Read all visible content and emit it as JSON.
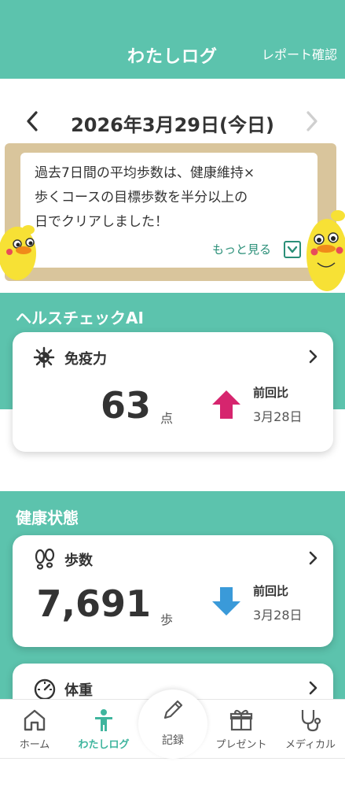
{
  "header": {
    "title": "わたしログ",
    "report_link": "レポート確認",
    "color": "#5cc3ad"
  },
  "date_nav": {
    "date": "2026年3月29日(今日)",
    "prev_icon": "chevron-left-icon",
    "next_icon": "chevron-right-icon"
  },
  "message_board": {
    "lines": [
      "過去7日間の平均歩数は、健康維持×",
      "歩くコースの目標歩数を半分以上の",
      "日でクリアしました！"
    ],
    "more_label": "もっと見る"
  },
  "health_check": {
    "section_title": "ヘルスチェックAI",
    "card": {
      "label": "免疫力",
      "icon": "virus-icon",
      "value": "63",
      "unit": "点",
      "trend": "up",
      "trend_color": "#d6256e",
      "compare_label": "前回比",
      "compare_date": "3月28日"
    }
  },
  "health_status": {
    "section_title": "健康状態",
    "steps_card": {
      "label": "歩数",
      "icon": "footprints-icon",
      "value": "7,691",
      "unit": "歩",
      "trend": "down",
      "trend_color": "#3a9ad9",
      "compare_label": "前回比",
      "compare_date": "3月28日"
    },
    "weight_card": {
      "label": "体重",
      "icon": "scale-icon"
    }
  },
  "bottom_nav": {
    "items": [
      {
        "label": "ホーム",
        "icon": "home-icon"
      },
      {
        "label": "わたしログ",
        "icon": "person-icon",
        "active": true
      },
      {
        "label": "記録",
        "icon": "pencil-icon"
      },
      {
        "label": "プレゼント",
        "icon": "gift-icon"
      },
      {
        "label": "メディカル",
        "icon": "stethoscope-icon"
      }
    ],
    "active_color": "#3fb59e"
  }
}
